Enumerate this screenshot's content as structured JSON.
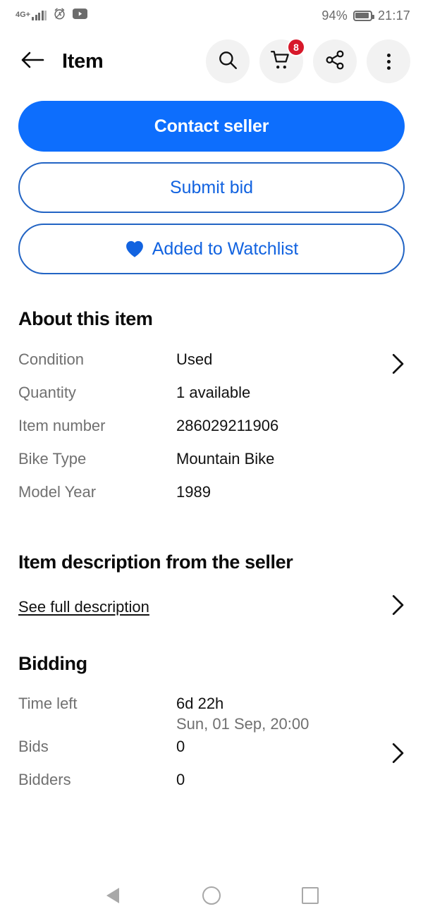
{
  "status_bar": {
    "network_label": "4G+",
    "icons": [
      "signal-bars-icon",
      "alarm-icon",
      "youtube-icon"
    ],
    "battery_percent": "94%",
    "time": "21:17"
  },
  "header": {
    "title": "Item",
    "back_icon": "back-arrow-icon",
    "actions": [
      {
        "name": "search",
        "icon": "search-icon"
      },
      {
        "name": "cart",
        "icon": "cart-icon",
        "badge": "8"
      },
      {
        "name": "share",
        "icon": "share-icon"
      },
      {
        "name": "more",
        "icon": "overflow-menu-icon"
      }
    ]
  },
  "actions": {
    "contact_seller": "Contact seller",
    "submit_bid": "Submit bid",
    "watchlist": "Added to Watchlist"
  },
  "about": {
    "title": "About this item",
    "rows": [
      {
        "label": "Condition",
        "value": "Used"
      },
      {
        "label": "Quantity",
        "value": "1 available"
      },
      {
        "label": "Item number",
        "value": "286029211906"
      },
      {
        "label": "Bike Type",
        "value": "Mountain Bike"
      },
      {
        "label": "Model Year",
        "value": "1989"
      }
    ]
  },
  "description": {
    "title": "Item description from the seller",
    "link": "See full description"
  },
  "bidding": {
    "title": "Bidding",
    "time_left_label": "Time left",
    "time_left_value": "6d 22h",
    "end_date": "Sun, 01 Sep, 20:00",
    "bids_label": "Bids",
    "bids_value": "0",
    "bidders_label": "Bidders",
    "bidders_value": "0"
  },
  "nav": {
    "back": "back-triangle-icon",
    "home": "home-circle-icon",
    "recents": "recents-square-icon"
  },
  "colors": {
    "accent_blue": "#0d6efd",
    "outline_blue": "#2264c4",
    "badge_red": "#d7182a",
    "label_gray": "#707070"
  }
}
